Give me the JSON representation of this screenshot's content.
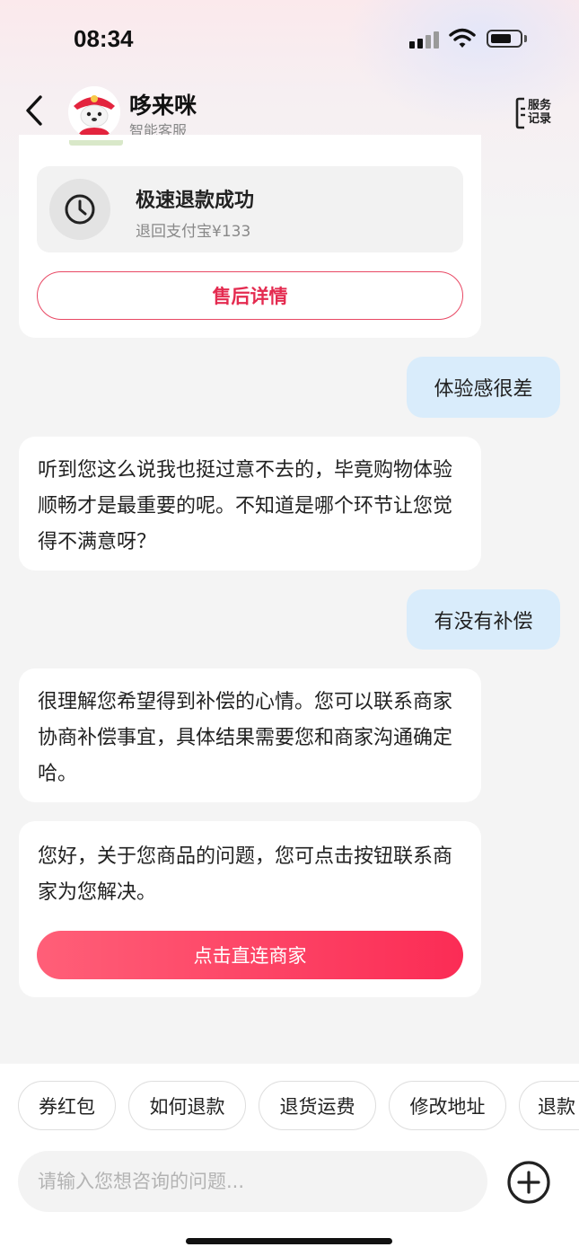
{
  "status_bar": {
    "time": "08:34"
  },
  "header": {
    "agent_name": "哆来咪",
    "agent_role": "智能客服",
    "service_record_label": "服务记录"
  },
  "refund_card": {
    "title": "极速退款成功",
    "subtitle": "退回支付宝¥133",
    "after_sale_button": "售后详情"
  },
  "messages": [
    {
      "from": "user",
      "text": "体验感很差"
    },
    {
      "from": "bot",
      "text": "听到您这么说我也挺过意不去的，毕竟购物体验顺畅才是最重要的呢。不知道是哪个环节让您觉得不满意呀？"
    },
    {
      "from": "user",
      "text": "有没有补偿"
    },
    {
      "from": "bot",
      "text": "很理解您希望得到补偿的心情。您可以联系商家协商补偿事宜，具体结果需要您和商家沟通确定哈。"
    },
    {
      "from": "bot",
      "text": "您好，关于您商品的问题，您可点击按钮联系商家为您解决。",
      "button": "点击直连商家"
    }
  ],
  "quick_replies": [
    "券红包",
    "如何退款",
    "退货运费",
    "修改地址",
    "退款"
  ],
  "input": {
    "placeholder": "请输入您想咨询的问题..."
  },
  "colors": {
    "accent": "#fb2c55",
    "user_bubble": "#d9ecfb",
    "background": "#f4f4f4"
  }
}
